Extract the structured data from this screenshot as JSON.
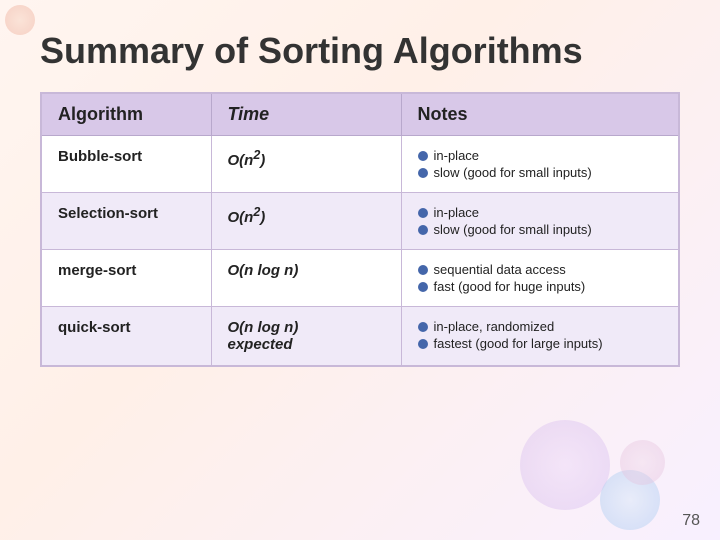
{
  "page": {
    "title": "Summary of Sorting Algorithms",
    "page_number": "78"
  },
  "table": {
    "headers": [
      "Algorithm",
      "Time",
      "Notes"
    ],
    "rows": [
      {
        "algorithm": "Bubble-sort",
        "time_html": "O(n²)",
        "notes": [
          "in-place",
          "slow (good for small inputs)"
        ]
      },
      {
        "algorithm": "Selection-sort",
        "time_html": "O(n²)",
        "notes": [
          "in-place",
          "slow (good for small inputs)"
        ]
      },
      {
        "algorithm": "merge-sort",
        "time_html": "O(n log n)",
        "notes": [
          "sequential data access",
          "fast (good for huge inputs)"
        ]
      },
      {
        "algorithm": "quick-sort",
        "time_html": "O(n log n) expected",
        "notes": [
          "in-place, randomized",
          "fastest (good for large inputs)"
        ]
      }
    ]
  }
}
